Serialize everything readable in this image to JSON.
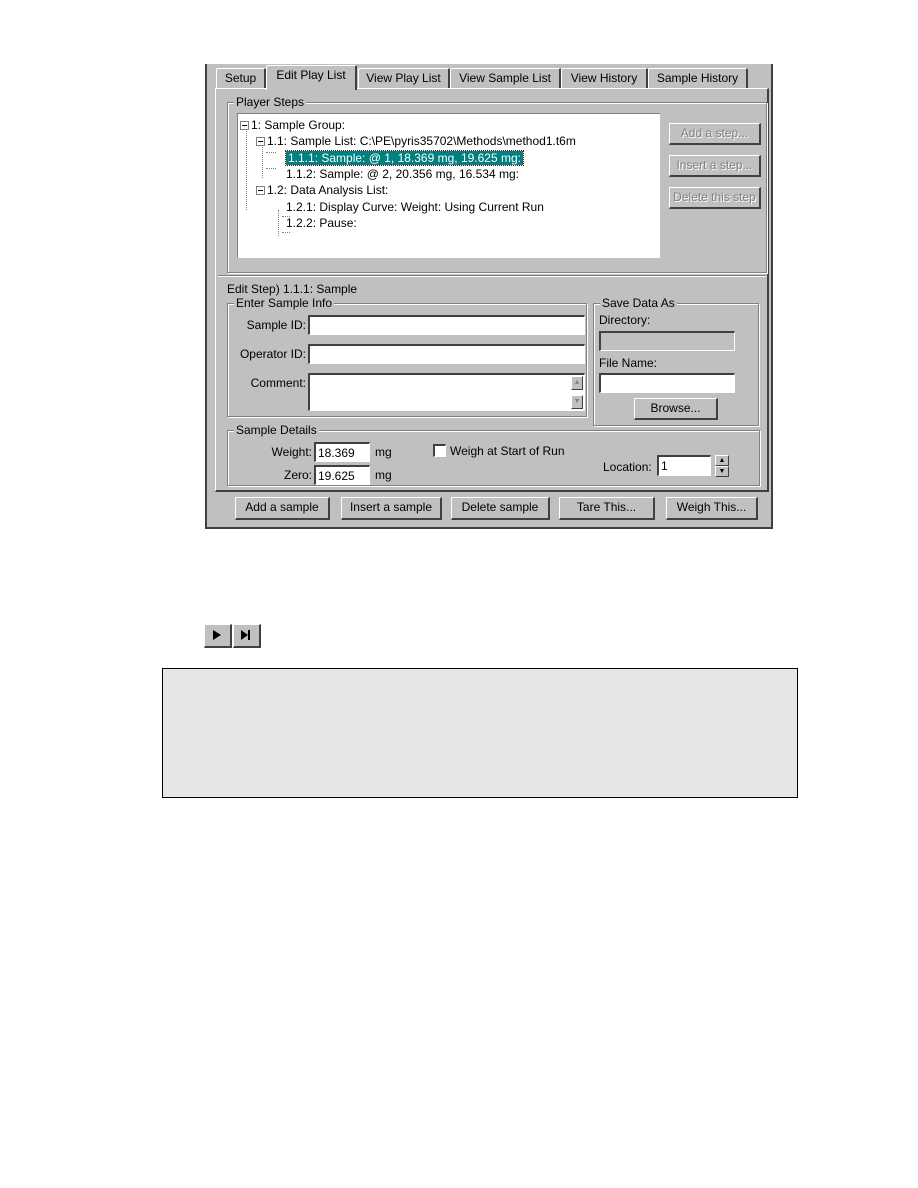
{
  "tabs": [
    {
      "label": "Setup",
      "active": false
    },
    {
      "label": "Edit Play List",
      "active": true
    },
    {
      "label": "View Play List",
      "active": false
    },
    {
      "label": "View Sample List",
      "active": false
    },
    {
      "label": "View History",
      "active": false
    },
    {
      "label": "Sample History",
      "active": false
    }
  ],
  "player_steps": {
    "title": "Player Steps",
    "tree": [
      {
        "label": "1: Sample Group:",
        "level": 0,
        "expanded": true,
        "selected": false
      },
      {
        "label": "1.1: Sample List: C:\\PE\\pyris35702\\Methods\\method1.t6m",
        "level": 1,
        "expanded": true,
        "selected": false
      },
      {
        "label": "1.1.1: Sample:  @ 1, 18.369 mg, 19.625 mg:",
        "level": 2,
        "selected": true
      },
      {
        "label": "1.1.2: Sample:  @ 2, 20.356 mg, 16.534 mg:",
        "level": 2,
        "selected": false
      },
      {
        "label": "1.2: Data Analysis List:",
        "level": 1,
        "expanded": true,
        "selected": false
      },
      {
        "label": "1.2.1: Display Curve: Weight: Using Current Run",
        "level": 2,
        "selected": false
      },
      {
        "label": "1.2.2: Pause:",
        "level": 2,
        "selected": false
      }
    ],
    "buttons": {
      "add_step": "Add a step...",
      "insert_step": "Insert a step...",
      "delete_step": "Delete this step"
    }
  },
  "edit_step": {
    "label": "Edit Step)  1.1.1: Sample"
  },
  "sample_info": {
    "title": "Enter Sample Info",
    "sample_id_label": "Sample ID:",
    "sample_id_value": "",
    "operator_id_label": "Operator ID:",
    "operator_id_value": "",
    "comment_label": "Comment:",
    "comment_value": ""
  },
  "save_data": {
    "title": "Save Data As",
    "directory_label": "Directory:",
    "directory_value": "",
    "file_name_label": "File Name:",
    "file_name_value": "",
    "browse_label": "Browse..."
  },
  "sample_details": {
    "title": "Sample Details",
    "weight_label": "Weight:",
    "weight_value": "18.369",
    "weight_unit": "mg",
    "zero_label": "Zero:",
    "zero_value": "19.625",
    "zero_unit": "mg",
    "weigh_at_start_label": "Weigh at Start of Run",
    "weigh_at_start_checked": false,
    "location_label": "Location:",
    "location_value": "1"
  },
  "bottom_buttons": {
    "add_sample": "Add a sample",
    "insert_sample": "Insert a sample",
    "delete_sample": "Delete sample",
    "tare_this": "Tare This...",
    "weigh_this": "Weigh This..."
  },
  "toolbar_icons": [
    {
      "name": "play-icon",
      "glyph": "▶"
    },
    {
      "name": "step-forward-icon",
      "glyph": "▶|"
    }
  ],
  "colors": {
    "selection": "#008080",
    "dialog_bg": "#c0c0c0",
    "note_box_bg": "#e6e6e6"
  }
}
